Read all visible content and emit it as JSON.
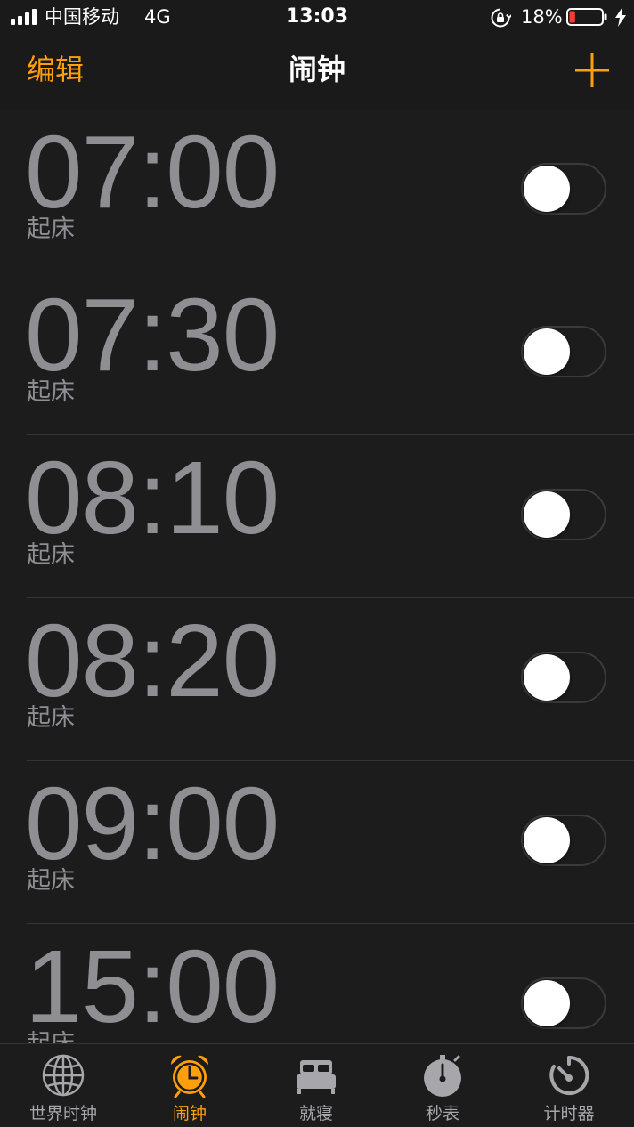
{
  "status_bar": {
    "carrier": "中国移动",
    "network": "4G",
    "time": "13:03",
    "battery_percent": "18%",
    "battery_level": 0.18,
    "icons": [
      "signal-icon",
      "rotation-lock-icon",
      "battery-icon",
      "charging-bolt-icon"
    ]
  },
  "nav": {
    "edit_label": "编辑",
    "title": "闹钟",
    "add_icon": "plus-icon"
  },
  "alarms": [
    {
      "time": "07:00",
      "label": "起床",
      "enabled": false
    },
    {
      "time": "07:30",
      "label": "起床",
      "enabled": false
    },
    {
      "time": "08:10",
      "label": "起床",
      "enabled": false
    },
    {
      "time": "08:20",
      "label": "起床",
      "enabled": false
    },
    {
      "time": "09:00",
      "label": "起床",
      "enabled": false
    },
    {
      "time": "15:00",
      "label": "起床",
      "enabled": false
    }
  ],
  "tabs": [
    {
      "label": "世界时钟",
      "icon": "globe-icon",
      "active": false
    },
    {
      "label": "闹钟",
      "icon": "alarm-clock-icon",
      "active": true
    },
    {
      "label": "就寝",
      "icon": "bed-icon",
      "active": false
    },
    {
      "label": "秒表",
      "icon": "stopwatch-icon",
      "active": false
    },
    {
      "label": "计时器",
      "icon": "timer-icon",
      "active": false
    }
  ],
  "colors": {
    "accent": "#ff9f0a",
    "background": "#1c1c1c",
    "inactive_text": "#8e8e93",
    "battery_low": "#ff3b30"
  }
}
